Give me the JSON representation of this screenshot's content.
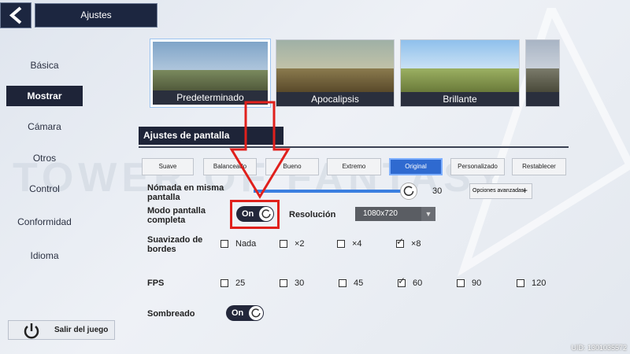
{
  "header": {
    "title": "Ajustes"
  },
  "sidebar": {
    "items": [
      {
        "label": "Básica"
      },
      {
        "label": "Mostrar"
      },
      {
        "label": "Cámara"
      },
      {
        "label": "Otros"
      },
      {
        "label": "Control"
      },
      {
        "label": "Conformidad"
      },
      {
        "label": "Idioma"
      }
    ],
    "active": "Mostrar",
    "exit_label": "Salir del juego"
  },
  "presets": [
    {
      "label": "Predeterminado"
    },
    {
      "label": "Apocalipsis"
    },
    {
      "label": "Brillante"
    }
  ],
  "section_title": "Ajustes de pantalla",
  "quality_buttons": [
    {
      "label": "Suave"
    },
    {
      "label": "Balanceado"
    },
    {
      "label": "Bueno"
    },
    {
      "label": "Extremo"
    },
    {
      "label": "Original"
    },
    {
      "label": "Personalizado"
    },
    {
      "label": "Restablecer"
    }
  ],
  "quality_selected": "Original",
  "settings": {
    "nomada_label": "Nómada en misma pantalla",
    "nomada_value": "30",
    "advanced_label": "Opciones avanzadas",
    "fullscreen_label": "Modo pantalla completa",
    "fullscreen_toggle": "On",
    "resolution_label": "Resolución",
    "resolution_value": "1080x720",
    "antialias_label": "Suavizado de bordes",
    "antialias_options": [
      "Nada",
      "×2",
      "×4",
      "×8"
    ],
    "antialias_selected": "×8",
    "fps_label": "FPS",
    "fps_options": [
      "25",
      "30",
      "45",
      "60",
      "90",
      "120"
    ],
    "fps_selected": "60",
    "shadow_label": "Sombreado",
    "shadow_toggle": "On"
  },
  "watermark": "TOWER OF FANTASY",
  "uid": "UID: 1301035572",
  "colors": {
    "accent": "#2f6ad0",
    "annotation_red": "#e0201c",
    "dark_panel": "#1e2438"
  }
}
